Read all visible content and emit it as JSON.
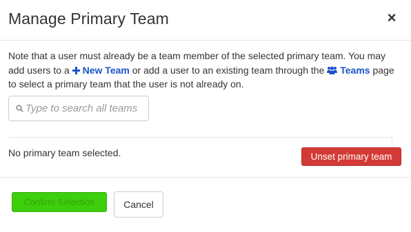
{
  "modal": {
    "title": "Manage Primary Team",
    "close_label": "×"
  },
  "note": {
    "part1": "Note that a user must already be a team member of the selected primary team. You may add users to a ",
    "new_team_link": "New Team",
    "part2": " or add a user to an existing team through the ",
    "teams_link": "Teams",
    "part3": " page to select a primary team that the user is not already on."
  },
  "search": {
    "placeholder": "Type to search all teams",
    "value": ""
  },
  "status": {
    "text": "No primary team selected."
  },
  "buttons": {
    "unset": "Unset primary team",
    "confirm": "Confirm Selection",
    "cancel": "Cancel"
  },
  "colors": {
    "link": "#1a53c9",
    "danger": "#d33a35",
    "success": "#33cc00"
  },
  "icons": [
    "close-icon",
    "plus-icon",
    "users-icon",
    "search-icon"
  ]
}
